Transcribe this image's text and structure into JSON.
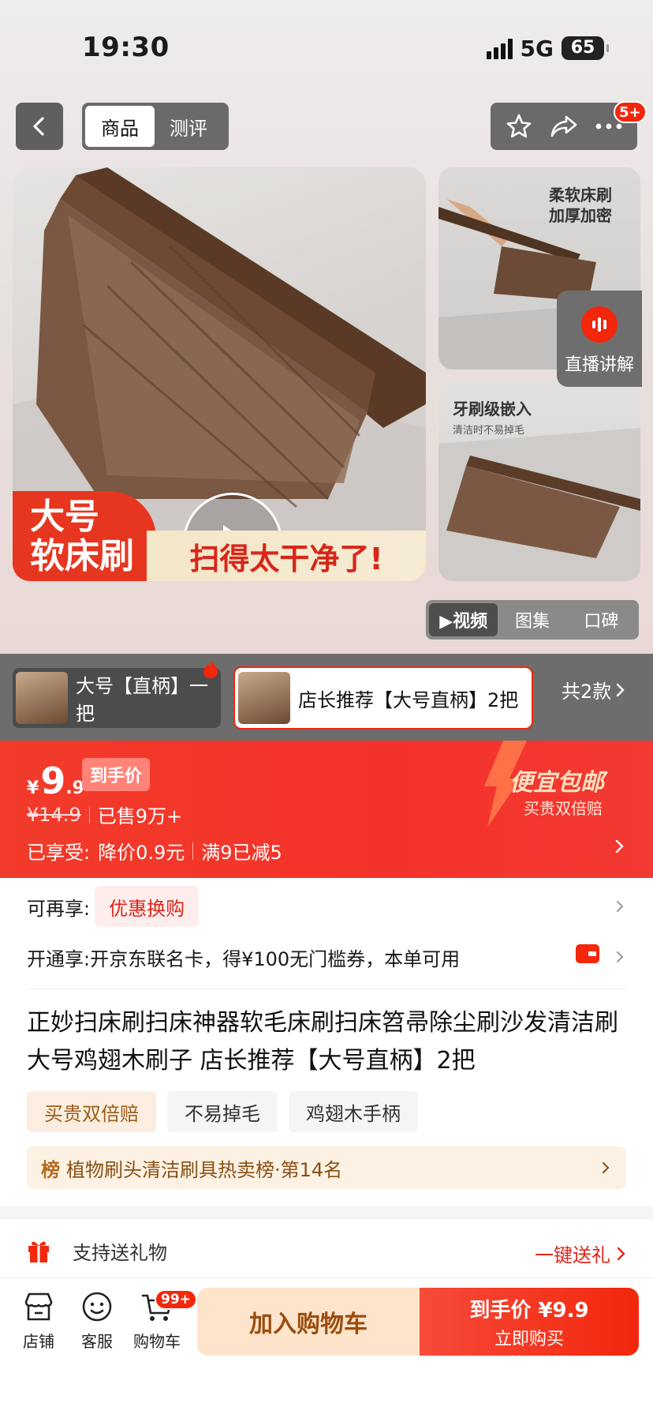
{
  "status_bar": {
    "time": "19:30",
    "network": "5G",
    "battery": "65"
  },
  "nav": {
    "tabs": [
      {
        "label": "商品"
      },
      {
        "label": "测评"
      }
    ],
    "notification_badge": "5+"
  },
  "gallery": {
    "banner_left_line1": "大号",
    "banner_left_line2": "软床刷",
    "banner_right": "扫得太干净了!",
    "side1_title_line1": "柔软床刷",
    "side1_title_line2": "加厚加密",
    "side2_title": "牙刷级嵌入",
    "side2_sub": "清洁时不易掉毛",
    "live_label": "直播讲解",
    "media_tabs": [
      {
        "label": "▶视频"
      },
      {
        "label": "图集"
      },
      {
        "label": "口碑"
      }
    ]
  },
  "variants": {
    "items": [
      {
        "label": "大号【直柄】一把"
      },
      {
        "label": "店长推荐【大号直柄】2把"
      }
    ],
    "total": "共2款"
  },
  "price": {
    "currency": "¥",
    "integer": "9",
    "decimal": ".9",
    "tag": "到手价",
    "original": "¥14.9",
    "sold": "已售9万+",
    "enjoyed_label": "已享受:",
    "discount1": "降价0.9元",
    "discount2": "满9已减5",
    "promo_title": "便宜包邮",
    "promo_sub": "买贵双倍赔"
  },
  "benefits": {
    "row1_label": "可再享:",
    "row1_tag": "优惠换购",
    "row2_text": "开通享:开京东联名卡，得¥100无门槛券，本单可用"
  },
  "product": {
    "title": "正妙扫床刷扫床神器软毛床刷扫床笤帚除尘刷沙发清洁刷大号鸡翅木刷子 店长推荐【大号直柄】2把",
    "tags": [
      {
        "label": "买贵双倍赔"
      },
      {
        "label": "不易掉毛"
      },
      {
        "label": "鸡翅木手柄"
      }
    ],
    "rank_icon": "榜",
    "rank_text": "植物刷头清洁刷具热卖榜·第14名"
  },
  "gift": {
    "label": "支持送礼物",
    "cta": "一键送礼"
  },
  "bottom_bar": {
    "store": "店铺",
    "service": "客服",
    "cart": "购物车",
    "cart_badge": "99+",
    "add_cart": "加入购物车",
    "buy_top": "到手价 ¥9.9",
    "buy_bottom": "立即购买"
  },
  "colors": {
    "accent": "#f2270c",
    "gold": "#9d5c1a"
  }
}
